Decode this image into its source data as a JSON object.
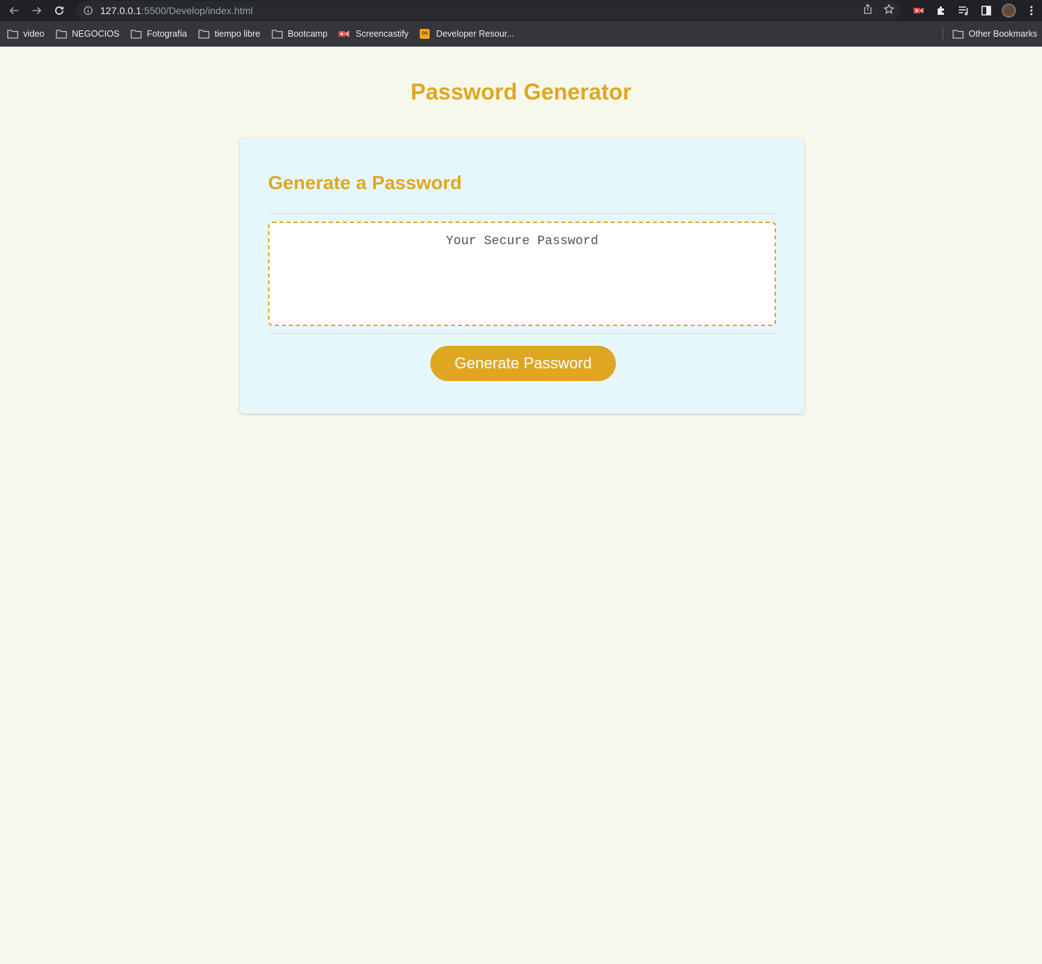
{
  "browser": {
    "url_host": "127.0.0.1",
    "url_rest": ":5500/Develop/index.html",
    "bookmarks": [
      {
        "label": "video",
        "icon": "folder-icon"
      },
      {
        "label": "NEGOCIOS",
        "icon": "folder-icon"
      },
      {
        "label": "Fotografía",
        "icon": "folder-icon"
      },
      {
        "label": "tiempo libre",
        "icon": "folder-icon"
      },
      {
        "label": "Bootcamp",
        "icon": "folder-icon"
      },
      {
        "label": "Screencastify",
        "icon": "screencastify-icon"
      },
      {
        "label": "Developer Resour...",
        "icon": "ds-icon"
      }
    ],
    "other_bookmarks": "Other Bookmarks"
  },
  "page": {
    "title": "Password Generator",
    "card_header": "Generate a Password",
    "password_placeholder": "Your Secure Password",
    "password_value": "",
    "generate_button": "Generate Password"
  },
  "colors": {
    "accent": "#dfa721",
    "page_bg": "#f7f8ec",
    "card_bg": "#e6f7fc"
  }
}
